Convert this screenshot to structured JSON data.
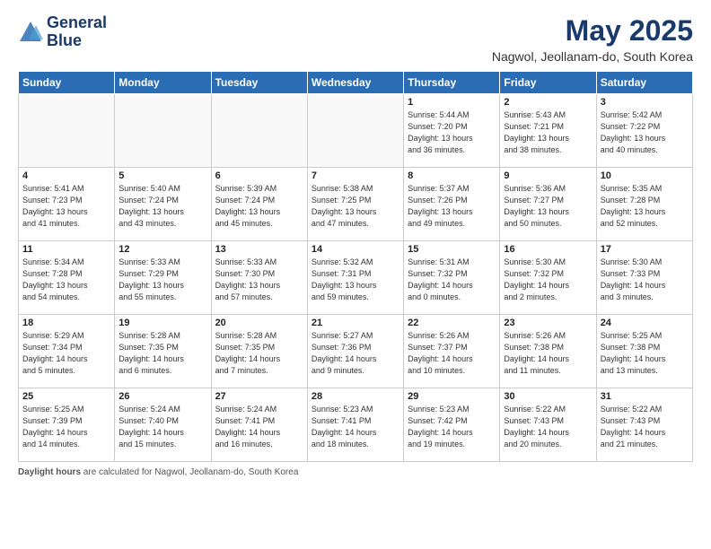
{
  "header": {
    "logo_line1": "General",
    "logo_line2": "Blue",
    "title": "May 2025",
    "subtitle": "Nagwol, Jeollanam-do, South Korea"
  },
  "days_of_week": [
    "Sunday",
    "Monday",
    "Tuesday",
    "Wednesday",
    "Thursday",
    "Friday",
    "Saturday"
  ],
  "weeks": [
    [
      {
        "day": "",
        "info": ""
      },
      {
        "day": "",
        "info": ""
      },
      {
        "day": "",
        "info": ""
      },
      {
        "day": "",
        "info": ""
      },
      {
        "day": "1",
        "info": "Sunrise: 5:44 AM\nSunset: 7:20 PM\nDaylight: 13 hours\nand 36 minutes."
      },
      {
        "day": "2",
        "info": "Sunrise: 5:43 AM\nSunset: 7:21 PM\nDaylight: 13 hours\nand 38 minutes."
      },
      {
        "day": "3",
        "info": "Sunrise: 5:42 AM\nSunset: 7:22 PM\nDaylight: 13 hours\nand 40 minutes."
      }
    ],
    [
      {
        "day": "4",
        "info": "Sunrise: 5:41 AM\nSunset: 7:23 PM\nDaylight: 13 hours\nand 41 minutes."
      },
      {
        "day": "5",
        "info": "Sunrise: 5:40 AM\nSunset: 7:24 PM\nDaylight: 13 hours\nand 43 minutes."
      },
      {
        "day": "6",
        "info": "Sunrise: 5:39 AM\nSunset: 7:24 PM\nDaylight: 13 hours\nand 45 minutes."
      },
      {
        "day": "7",
        "info": "Sunrise: 5:38 AM\nSunset: 7:25 PM\nDaylight: 13 hours\nand 47 minutes."
      },
      {
        "day": "8",
        "info": "Sunrise: 5:37 AM\nSunset: 7:26 PM\nDaylight: 13 hours\nand 49 minutes."
      },
      {
        "day": "9",
        "info": "Sunrise: 5:36 AM\nSunset: 7:27 PM\nDaylight: 13 hours\nand 50 minutes."
      },
      {
        "day": "10",
        "info": "Sunrise: 5:35 AM\nSunset: 7:28 PM\nDaylight: 13 hours\nand 52 minutes."
      }
    ],
    [
      {
        "day": "11",
        "info": "Sunrise: 5:34 AM\nSunset: 7:28 PM\nDaylight: 13 hours\nand 54 minutes."
      },
      {
        "day": "12",
        "info": "Sunrise: 5:33 AM\nSunset: 7:29 PM\nDaylight: 13 hours\nand 55 minutes."
      },
      {
        "day": "13",
        "info": "Sunrise: 5:33 AM\nSunset: 7:30 PM\nDaylight: 13 hours\nand 57 minutes."
      },
      {
        "day": "14",
        "info": "Sunrise: 5:32 AM\nSunset: 7:31 PM\nDaylight: 13 hours\nand 59 minutes."
      },
      {
        "day": "15",
        "info": "Sunrise: 5:31 AM\nSunset: 7:32 PM\nDaylight: 14 hours\nand 0 minutes."
      },
      {
        "day": "16",
        "info": "Sunrise: 5:30 AM\nSunset: 7:32 PM\nDaylight: 14 hours\nand 2 minutes."
      },
      {
        "day": "17",
        "info": "Sunrise: 5:30 AM\nSunset: 7:33 PM\nDaylight: 14 hours\nand 3 minutes."
      }
    ],
    [
      {
        "day": "18",
        "info": "Sunrise: 5:29 AM\nSunset: 7:34 PM\nDaylight: 14 hours\nand 5 minutes."
      },
      {
        "day": "19",
        "info": "Sunrise: 5:28 AM\nSunset: 7:35 PM\nDaylight: 14 hours\nand 6 minutes."
      },
      {
        "day": "20",
        "info": "Sunrise: 5:28 AM\nSunset: 7:35 PM\nDaylight: 14 hours\nand 7 minutes."
      },
      {
        "day": "21",
        "info": "Sunrise: 5:27 AM\nSunset: 7:36 PM\nDaylight: 14 hours\nand 9 minutes."
      },
      {
        "day": "22",
        "info": "Sunrise: 5:26 AM\nSunset: 7:37 PM\nDaylight: 14 hours\nand 10 minutes."
      },
      {
        "day": "23",
        "info": "Sunrise: 5:26 AM\nSunset: 7:38 PM\nDaylight: 14 hours\nand 11 minutes."
      },
      {
        "day": "24",
        "info": "Sunrise: 5:25 AM\nSunset: 7:38 PM\nDaylight: 14 hours\nand 13 minutes."
      }
    ],
    [
      {
        "day": "25",
        "info": "Sunrise: 5:25 AM\nSunset: 7:39 PM\nDaylight: 14 hours\nand 14 minutes."
      },
      {
        "day": "26",
        "info": "Sunrise: 5:24 AM\nSunset: 7:40 PM\nDaylight: 14 hours\nand 15 minutes."
      },
      {
        "day": "27",
        "info": "Sunrise: 5:24 AM\nSunset: 7:41 PM\nDaylight: 14 hours\nand 16 minutes."
      },
      {
        "day": "28",
        "info": "Sunrise: 5:23 AM\nSunset: 7:41 PM\nDaylight: 14 hours\nand 18 minutes."
      },
      {
        "day": "29",
        "info": "Sunrise: 5:23 AM\nSunset: 7:42 PM\nDaylight: 14 hours\nand 19 minutes."
      },
      {
        "day": "30",
        "info": "Sunrise: 5:22 AM\nSunset: 7:43 PM\nDaylight: 14 hours\nand 20 minutes."
      },
      {
        "day": "31",
        "info": "Sunrise: 5:22 AM\nSunset: 7:43 PM\nDaylight: 14 hours\nand 21 minutes."
      }
    ]
  ],
  "footer": {
    "label": "Daylight hours",
    "text": "are calculated for Nagwol, Jeollanam-do, South Korea"
  }
}
